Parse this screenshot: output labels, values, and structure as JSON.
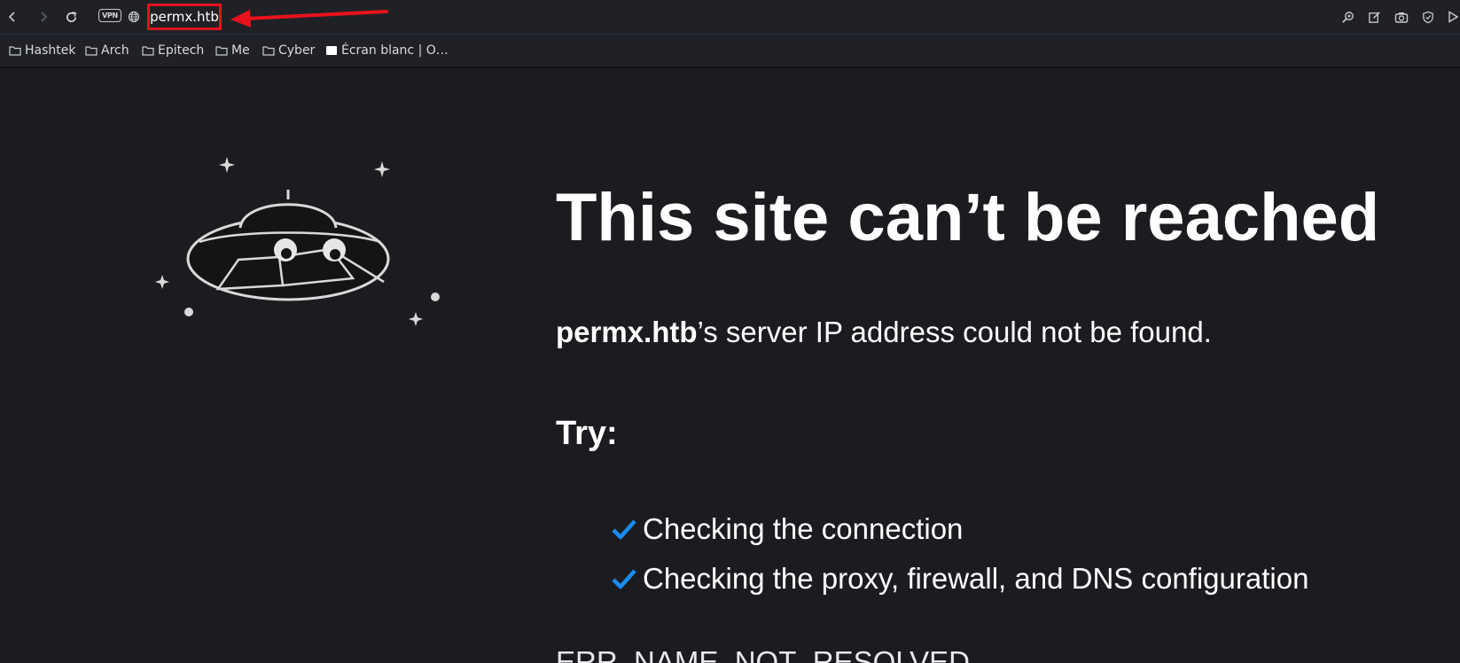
{
  "browser": {
    "address": {
      "vpn_badge": "VPN",
      "url": "permx.htb"
    },
    "toolbar_icons": [
      "back-icon",
      "forward-icon",
      "reload-icon",
      "globe-icon",
      "zoom-icon",
      "edit-icon",
      "camera-icon",
      "shield-icon",
      "play-icon"
    ],
    "annotation_color": "#e8121c"
  },
  "bookmarks": [
    {
      "label": "Hashtek",
      "icon": "folder-icon"
    },
    {
      "label": "Arch",
      "icon": "folder-icon"
    },
    {
      "label": "Epitech",
      "icon": "folder-icon"
    },
    {
      "label": "Me",
      "icon": "folder-icon"
    },
    {
      "label": "Cyber",
      "icon": "folder-icon"
    },
    {
      "label": "Écran blanc | O…",
      "icon": "page-icon"
    }
  ],
  "error_page": {
    "headline": "This site can’t be reached",
    "host": "permx.htb",
    "message_suffix": "’s server IP address could not be found.",
    "try_label": "Try:",
    "suggestions": [
      "Checking the connection",
      "Checking the proxy, firewall, and DNS configuration"
    ],
    "error_code": "ERR_NAME_NOT_RESOLVED",
    "check_color": "#1a8cf0"
  }
}
